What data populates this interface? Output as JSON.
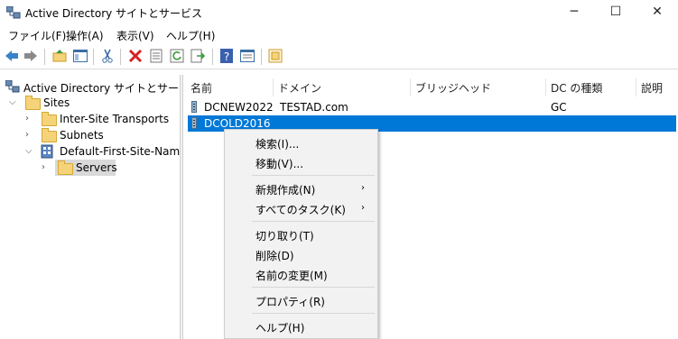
{
  "window": {
    "title": "Active Directory サイトとサービス",
    "minimize": "─",
    "maximize": "☐",
    "close": "✕"
  },
  "menu": [
    "ファイル(F)",
    "操作(A)",
    "表示(V)",
    "ヘルプ(H)"
  ],
  "toolbar": {
    "buttons": [
      "back-icon",
      "forward-icon",
      "up-folder-icon",
      "show-tree-icon",
      "cut-icon",
      "delete-icon",
      "properties-icon",
      "refresh-icon",
      "export-icon",
      "help-icon",
      "view-icon",
      "new-window-icon"
    ]
  },
  "tree": {
    "root": "Active Directory サイトとサービス [l",
    "sites": "Sites",
    "inter_site": "Inter-Site Transports",
    "subnets": "Subnets",
    "default_site": "Default-First-Site-Name",
    "servers": "Servers"
  },
  "list": {
    "columns": [
      "名前",
      "ドメイン",
      "ブリッジヘッド",
      "DC の種類",
      "説明"
    ],
    "rows": [
      {
        "name": "DCNEW2022",
        "domain": "TESTAD.com",
        "bridgehead": "",
        "dc_type": "GC",
        "description": ""
      },
      {
        "name": "DCOLD2016",
        "domain": "",
        "bridgehead": "",
        "dc_type": "",
        "description": "",
        "selected": true
      }
    ]
  },
  "context_menu": {
    "items": [
      "検索(I)...",
      "移動(V)...",
      "新規作成(N)",
      "すべてのタスク(K)",
      "切り取り(T)",
      "削除(D)",
      "名前の変更(M)",
      "プロパティ(R)",
      "ヘルプ(H)"
    ],
    "submenu_arrow": "›"
  },
  "colors": {
    "selection": "#0078d7",
    "folder": "#f5d37a"
  }
}
